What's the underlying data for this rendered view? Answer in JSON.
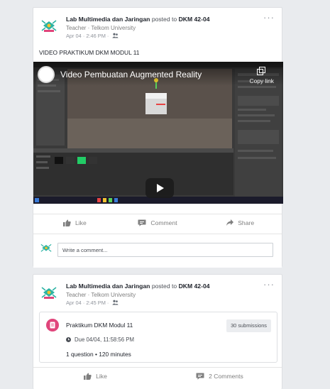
{
  "posts": [
    {
      "author": "Lab Multimedia dan Jaringan",
      "posted_to": "posted to",
      "group": "DKM 42-04",
      "role": "Teacher · Telkom University",
      "time": "Apr 04 · 2:46 PM ·",
      "text": "VIDEO PRAKTIKUM DKM MODUL 11",
      "video": {
        "title": "Video Pembuatan Augmented Reality",
        "copy_label": "Copy link"
      },
      "actions": {
        "like": "Like",
        "comment": "Comment",
        "share": "Share"
      },
      "comment_placeholder": "Write a comment..."
    },
    {
      "author": "Lab Multimedia dan Jaringan",
      "posted_to": "posted to",
      "group": "DKM 42-04",
      "role": "Teacher · Telkom University",
      "time": "Apr 04 · 2:45 PM ·",
      "assignment": {
        "title": "Praktikum DKM Modul 11",
        "submissions": "30 submissions",
        "due": "Due 04/04, 11:58:56 PM",
        "details": "1 question • 120 minutes"
      },
      "actions": {
        "like": "Like",
        "comments": "2 Comments"
      }
    }
  ],
  "icons": {
    "menu": "ellipsis-icon",
    "privacy": "group-privacy-icon",
    "like": "thumbs-up-icon",
    "comment": "speech-bubble-icon",
    "share": "share-arrow-icon",
    "copy": "copy-icon",
    "play": "play-icon",
    "assignment": "assignment-icon",
    "due": "clock-icon"
  },
  "colors": {
    "background": "#e9ebee",
    "card_border": "#dddfe2",
    "assignment_accent": "#e0457b",
    "muted_text": "#7f7f7f"
  }
}
